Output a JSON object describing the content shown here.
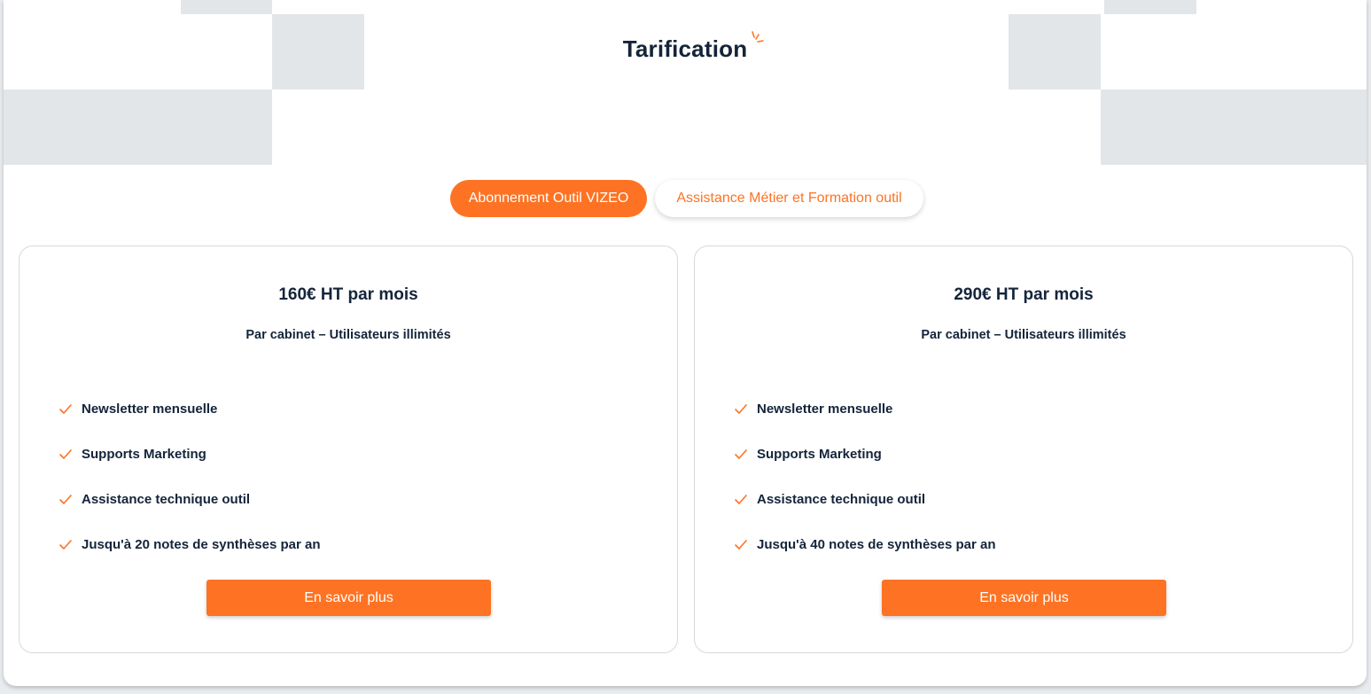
{
  "page": {
    "title": "Tarification"
  },
  "theme": {
    "accent": "#fd7323",
    "text": "#14243a",
    "decor": "#e2e6e9"
  },
  "tabs": [
    {
      "label": "Abonnement Outil VIZEO",
      "active": true
    },
    {
      "label": "Assistance Métier et Formation outil",
      "active": false
    }
  ],
  "plans": [
    {
      "price": "160€ HT par mois",
      "subtitle": "Par cabinet – Utilisateurs illimités",
      "features": [
        "Newsletter mensuelle",
        "Supports Marketing",
        "Assistance technique outil",
        "Jusqu'à 20 notes de synthèses par an"
      ],
      "cta": "En savoir plus"
    },
    {
      "price": "290€ HT par mois",
      "subtitle": "Par cabinet – Utilisateurs illimités",
      "features": [
        "Newsletter mensuelle",
        "Supports Marketing",
        "Assistance technique outil",
        "Jusqu'à 40 notes de synthèses par an"
      ],
      "cta": "En savoir plus"
    }
  ],
  "icons": {
    "check": "check-icon",
    "spark": "spark-icon"
  }
}
